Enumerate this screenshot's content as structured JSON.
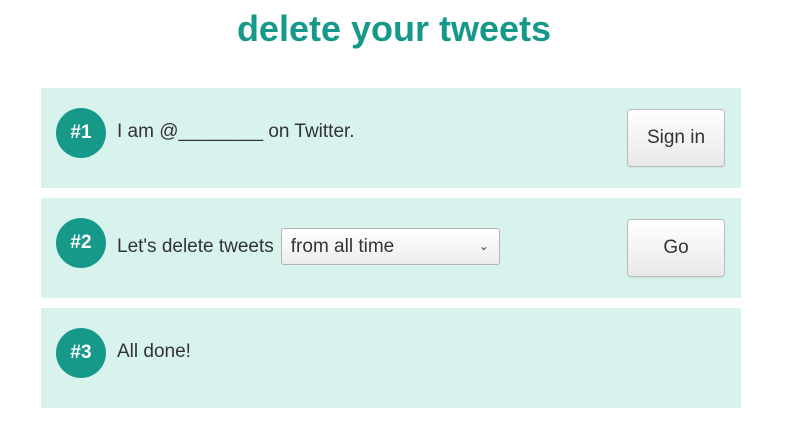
{
  "page": {
    "title": "delete your tweets"
  },
  "steps": [
    {
      "badge": "#1",
      "text": "I am @________ on Twitter.",
      "button": "Sign in"
    },
    {
      "badge": "#2",
      "text": "Let's delete tweets",
      "select": {
        "selected": "from all time"
      },
      "button": "Go"
    },
    {
      "badge": "#3",
      "text": "All done!"
    }
  ],
  "colors": {
    "accent": "#17998a",
    "panel": "#d8f3ee"
  }
}
